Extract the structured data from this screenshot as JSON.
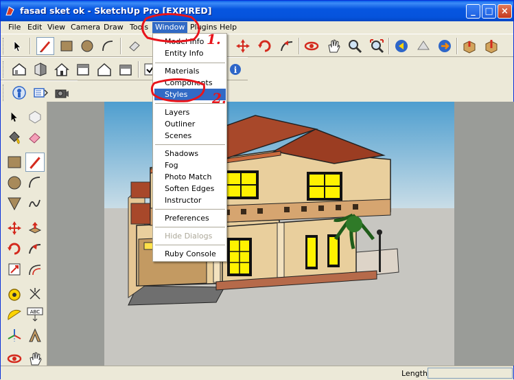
{
  "window": {
    "title": "fasad sket ok - SketchUp Pro [EXPIRED]",
    "minimize_symbol": "_",
    "maximize_symbol": "□",
    "close_symbol": "×"
  },
  "menubar": {
    "items": [
      {
        "label": "File"
      },
      {
        "label": "Edit"
      },
      {
        "label": "View"
      },
      {
        "label": "Camera"
      },
      {
        "label": "Draw"
      },
      {
        "label": "Tools"
      },
      {
        "label": "Window"
      },
      {
        "label": "Plugins"
      },
      {
        "label": "Help"
      }
    ],
    "active": "Window"
  },
  "window_menu": {
    "groups": [
      [
        "Model Info",
        "Entity Info"
      ],
      [
        "Materials",
        "Components",
        "Styles"
      ],
      [
        "Layers",
        "Outliner",
        "Scenes"
      ],
      [
        "Shadows",
        "Fog",
        "Photo Match",
        "Soften Edges",
        "Instructor"
      ],
      [
        "Preferences"
      ],
      [
        "Hide Dialogs"
      ],
      [
        "Ruby Console"
      ]
    ],
    "highlighted": "Styles",
    "disabled": [
      "Hide Dialogs"
    ]
  },
  "annotations": {
    "step1": "1.",
    "step2": "2.",
    "color": "#e8141b"
  },
  "toolbar_icons": {
    "row1": [
      "select-icon",
      "pencil-icon",
      "rectangle-icon",
      "circle-icon",
      "arc-icon",
      "eraser-icon",
      "move-icon",
      "rotate-icon",
      "followme-icon",
      "orbit-icon",
      "pan-icon",
      "zoom-icon",
      "zoom-extents-icon",
      "previous-icon",
      "next-icon",
      "get-models-icon",
      "share-model-icon",
      "get-components-icon",
      "share-component-icon"
    ],
    "row2": [
      "iso-view-icon",
      "front-view-icon",
      "house-icon",
      "back-view-icon",
      "left-view-icon",
      "right-view-icon",
      "checkbox-icon",
      "info-icon"
    ],
    "row3": [
      "walk-icon",
      "section-icon",
      "camera-icon"
    ]
  },
  "statusbar": {
    "measure_label": "Length",
    "measure_value": ""
  },
  "colors": {
    "title_bar": "#0553dc",
    "menu_highlight": "#316ac5",
    "chrome": "#ece9d8",
    "sky_top": "#4e9ecf",
    "ground": "#c7c6c1",
    "roof": "#a8482a",
    "wall": "#e9cf9d",
    "window_glow": "#fff200"
  }
}
